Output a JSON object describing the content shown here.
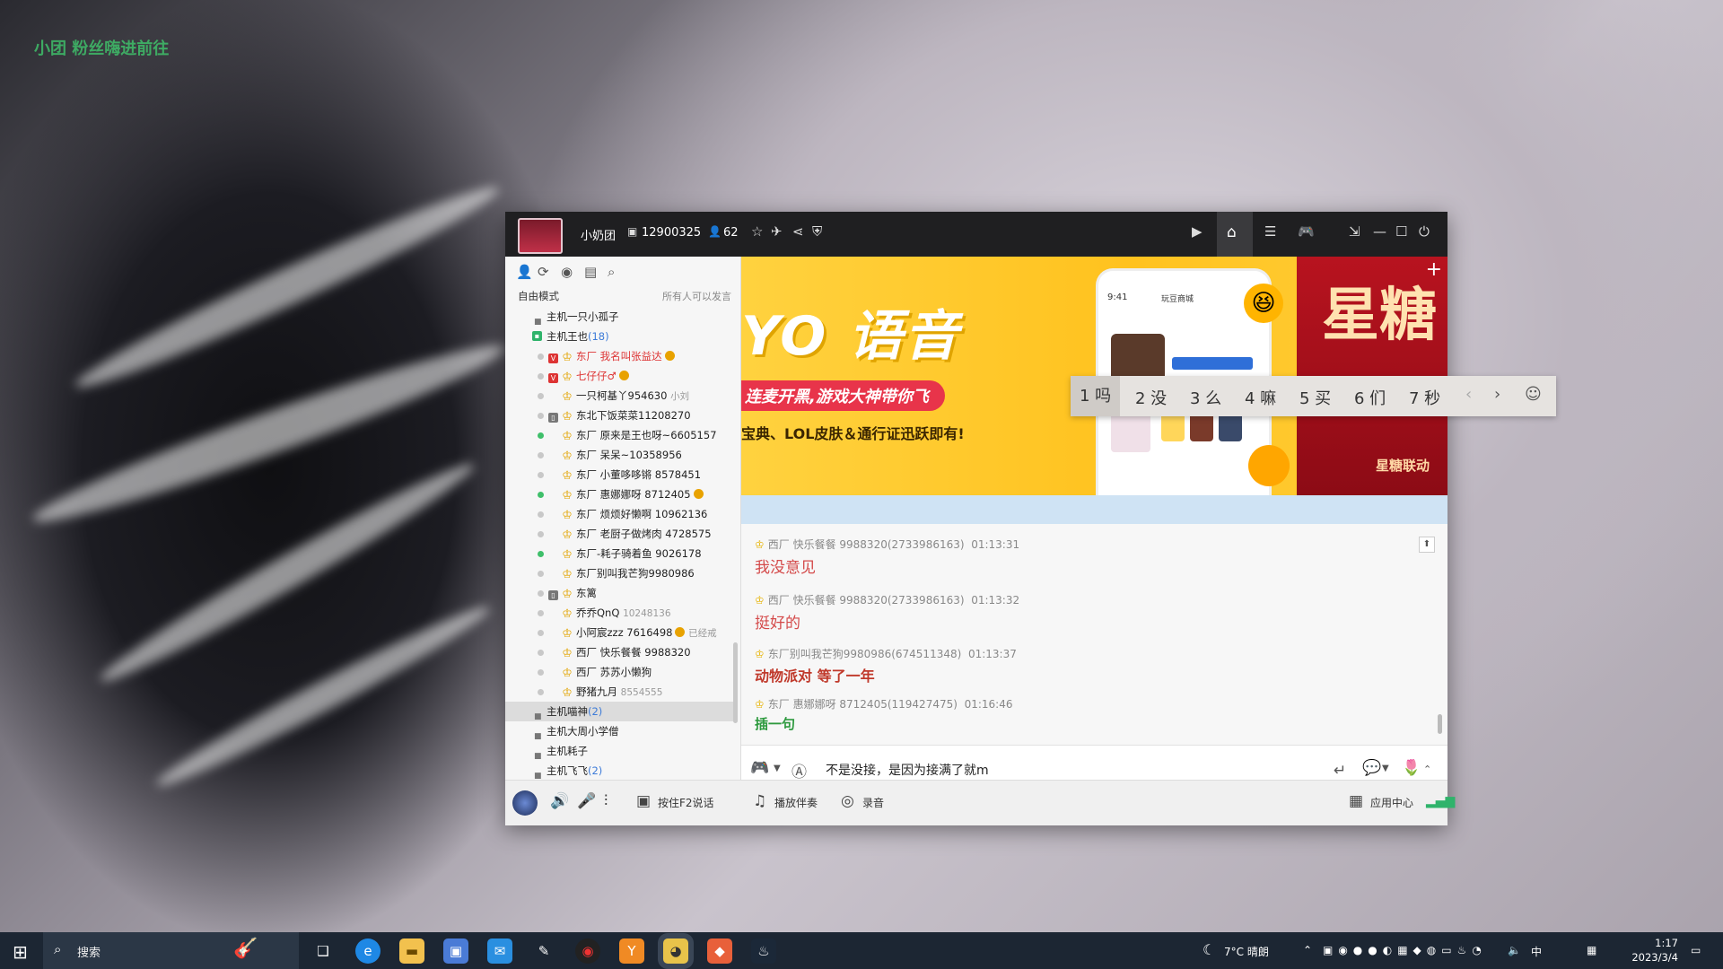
{
  "desktop": {
    "overlay_text": "小团 粉丝嗨进前往"
  },
  "window": {
    "title": "小奶团",
    "room_id": "12900325",
    "online_count": "62"
  },
  "sidebar": {
    "mode": "自由模式",
    "mode_note": "所有人可以发言",
    "channels": [
      {
        "name": "主机一只小孤子"
      },
      {
        "name": "主机王也",
        "count": "(18)"
      },
      {
        "name": "东厂 我名叫张益达",
        "tag": "red"
      },
      {
        "name": "七仔仔♂",
        "tag": "red"
      },
      {
        "name": "一只柯基丫954630",
        "extra": "小刘"
      },
      {
        "name": "东北下饭菜菜11208270"
      },
      {
        "name": "东厂 原来是王也呀~6605157"
      },
      {
        "name": "东厂 呆呆~10358956"
      },
      {
        "name": "东厂 小董哆哆锵 8578451"
      },
      {
        "name": "东厂 惠娜娜呀 8712405"
      },
      {
        "name": "东厂 烦烦好懒啊 10962136"
      },
      {
        "name": "东厂 老厨子做烤肉 4728575"
      },
      {
        "name": "东厂-耗子骑着鱼 9026178"
      },
      {
        "name": "东厂别叫我芒狗9980986"
      },
      {
        "name": "东篱"
      },
      {
        "name": "乔乔QnQ",
        "extra": "10248136"
      },
      {
        "name": "小阿宸zzz 7616498",
        "extra": "已经戒"
      },
      {
        "name": "西厂 快乐餐餐 9988320"
      },
      {
        "name": "西厂 苏苏小懒狗"
      },
      {
        "name": "野猪九月",
        "extra": "8554555"
      },
      {
        "name": "主机喵神",
        "count": "(2)"
      },
      {
        "name": "主机大周小学僧"
      },
      {
        "name": "主机耗子"
      },
      {
        "name": "主机飞飞",
        "count": "(2)"
      }
    ]
  },
  "banner": {
    "title": "YO 语音",
    "pill": "连麦开黑,游戏大神带你飞",
    "sub": "宝典、LOL皮肤＆通行证迅跃即有!",
    "phone_time": "9:41",
    "phone_title": "玩豆商城",
    "side_big": "星糖",
    "side_foot": "星糖联动"
  },
  "chat": {
    "messages": [
      {
        "sender": "西厂 快乐餐餐 9988320(2733986163)",
        "time": "01:13:31",
        "text": "我没意见",
        "style": "red"
      },
      {
        "sender": "西厂 快乐餐餐 9988320(2733986163)",
        "time": "01:13:32",
        "text": "挺好的",
        "style": "red"
      },
      {
        "sender": "东厂别叫我芒狗9980986(674511348)",
        "time": "01:13:37",
        "text": "动物派对  等了一年",
        "style": "brown"
      },
      {
        "sender": "东厂 惠娜娜呀 8712405(119427475)",
        "time": "01:16:46",
        "text": "插一句",
        "style": "green"
      }
    ]
  },
  "input": {
    "value": "不是没接，是因为接满了就m"
  },
  "bottom": {
    "ptt": "按住F2说话",
    "music": "播放伴奏",
    "record": "录音",
    "app_center": "应用中心"
  },
  "ime": {
    "candidates": [
      "1 吗",
      "2 没",
      "3 么",
      "4 嘛",
      "5 买",
      "6 们",
      "7 秒"
    ]
  },
  "taskbar": {
    "search": "搜索",
    "weather": "7°C  晴朗",
    "ime_lang": "中",
    "time": "1:17",
    "date": "2023/3/4"
  },
  "colors": {
    "accent_red": "#d33333",
    "banner_yellow": "#ffc21e",
    "chat_green": "#2e9a3f"
  }
}
